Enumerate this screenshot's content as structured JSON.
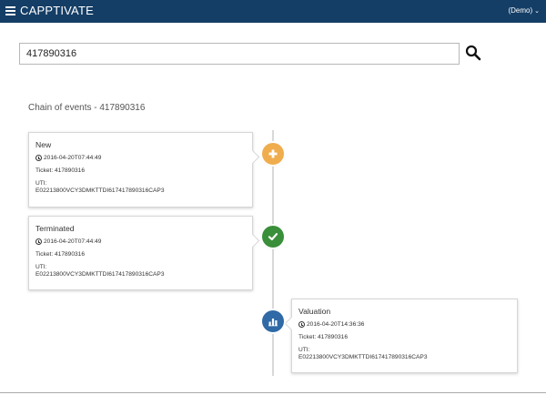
{
  "app": {
    "brand": "CAPPTIVATE",
    "user_menu": "(Demo)"
  },
  "search": {
    "value": "417890316",
    "placeholder": ""
  },
  "chain": {
    "title": "Chain of events - 417890316"
  },
  "events": [
    {
      "title": "New",
      "timestamp": "2016-04-20T07:44:49",
      "ticket": "Ticket: 417890316",
      "uti_label": "UTI:",
      "uti": "E02213800VCY3DMKTTDI617417890316CAP3",
      "icon": "plus-icon",
      "color": "#f0ad4e"
    },
    {
      "title": "Terminated",
      "timestamp": "2016-04-20T07:44:49",
      "ticket": "Ticket: 417890316",
      "uti_label": "UTI:",
      "uti": "E02213800VCY3DMKTTDI617417890316CAP3",
      "icon": "check-icon",
      "color": "#3a8f3a"
    },
    {
      "title": "Valuation",
      "timestamp": "2016-04-20T14:36:36",
      "ticket": "Ticket: 417890316",
      "uti_label": "UTI:",
      "uti": "E02213800VCY3DMKTTDI617417890316CAP3",
      "icon": "bar-chart-icon",
      "color": "#2f6aa6"
    }
  ]
}
